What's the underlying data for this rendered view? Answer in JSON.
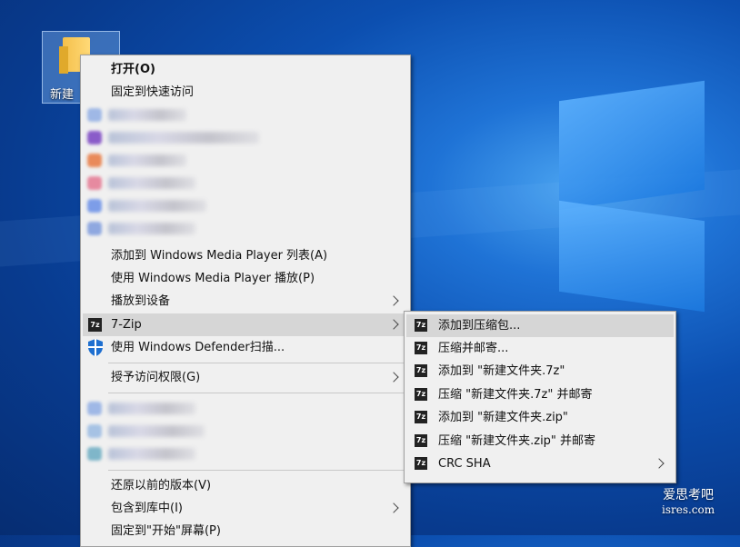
{
  "desktop": {
    "folder_label": "新建",
    "watermark_line1": "爱思考吧",
    "watermark_line2": "isres.com"
  },
  "context_menu": {
    "open": "打开(O)",
    "pin_quick_access": "固定到快速访问",
    "add_wmp_list": "添加到 Windows Media Player 列表(A)",
    "play_wmp": "使用 Windows Media Player 播放(P)",
    "cast_device": "播放到设备",
    "seven_zip": "7-Zip",
    "defender_scan": "使用 Windows Defender扫描...",
    "grant_access": "授予访问权限(G)",
    "restore_versions": "还原以前的版本(V)",
    "include_library": "包含到库中(I)",
    "pin_start": "固定到\"开始\"屏幕(P)"
  },
  "submenu_7zip": {
    "items": [
      "添加到压缩包...",
      "压缩并邮寄...",
      "添加到 \"新建文件夹.7z\"",
      "压缩 \"新建文件夹.7z\" 并邮寄",
      "添加到 \"新建文件夹.zip\"",
      "压缩 \"新建文件夹.zip\" 并邮寄",
      "CRC SHA"
    ],
    "icon_text": "7z"
  },
  "colors": {
    "menu_bg": "#f0f0f0",
    "highlight": "#d6d6d6",
    "desktop_blue": "#0c4fb0"
  }
}
